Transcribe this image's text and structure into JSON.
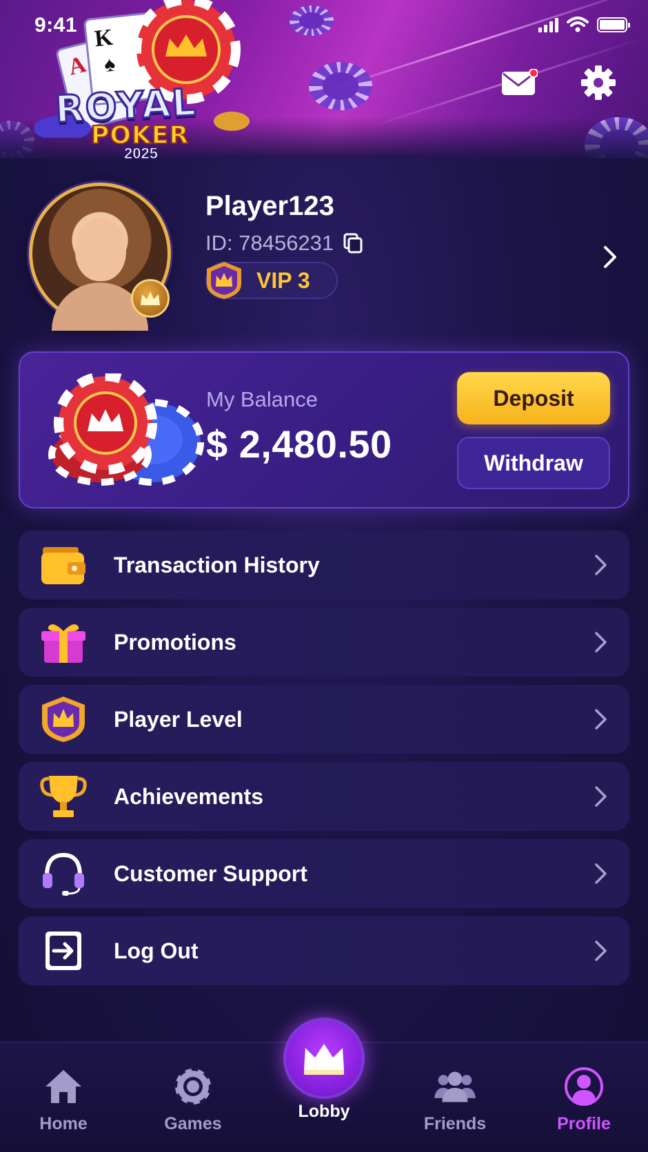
{
  "status_bar": {
    "time": "9:41"
  },
  "logo": {
    "line1": "ROYAL",
    "line2": "POKER",
    "line3": "2025"
  },
  "profile": {
    "name": "Player123",
    "id_text": "ID: 78456231",
    "vip_label": "VIP 3"
  },
  "balance": {
    "label": "My Balance",
    "value": "$ 2,480.50",
    "deposit_label": "Deposit",
    "withdraw_label": "Withdraw"
  },
  "menu": {
    "items": [
      {
        "label": "Transaction History",
        "icon": "wallet-icon"
      },
      {
        "label": "Promotions",
        "icon": "gift-icon"
      },
      {
        "label": "Player Level",
        "icon": "crown-shield-icon"
      },
      {
        "label": "Achievements",
        "icon": "trophy-icon"
      },
      {
        "label": "Customer Support",
        "icon": "headset-icon"
      },
      {
        "label": "Log Out",
        "icon": "logout-icon"
      }
    ]
  },
  "nav": {
    "home": "Home",
    "games": "Games",
    "lobby": "Lobby",
    "friends": "Friends",
    "profile": "Profile",
    "active": "Profile"
  },
  "colors": {
    "accent": "#d054ff",
    "gold": "#ffc533",
    "deposit": "#f7b21c",
    "background": "#1c1447"
  }
}
